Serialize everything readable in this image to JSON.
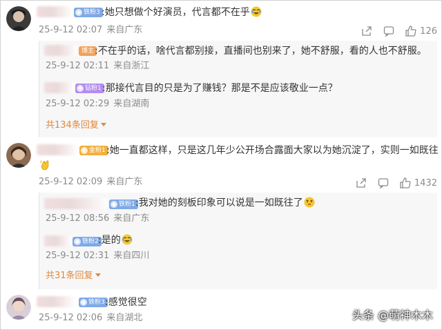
{
  "comments": [
    {
      "badge": "铁粉3",
      "badge_color": "#7fa9e6",
      "text": ":她只想做个好演员，代言都不在乎",
      "date": "25-9-12 02:07",
      "location": "来自广东",
      "likes": "126",
      "replies": [
        {
          "badge": "博主",
          "badge_color": "#f0a35c",
          "text": ":不在乎的话，啥代言都别接，直播间也别来了，她不舒服，看的人也不舒服。",
          "date": "25-9-12 02:11",
          "location": "来自浙江"
        },
        {
          "badge": "钻粉1",
          "badge_color": "#b38cf0",
          "text": ":那接代言目的只是为了赚钱？那是不是应该敬业一点？",
          "date": "25-9-12 02:29",
          "location": "来自湖南"
        }
      ],
      "more_replies": "共134条回复"
    },
    {
      "badge": "金粉1",
      "badge_color": "#f2b03c",
      "text": ":她一直都这样，只是这几年少公开场合露面大家以为她沉淀了，实则一如既往",
      "date": "25-9-12 02:09",
      "location": "来自广东",
      "likes": "1432",
      "replies": [
        {
          "badge": "铁粉1",
          "badge_color": "#7fa9e6",
          "text": ":我对她的刻板印象可以说是一如既往了",
          "date": "25-9-12 08:56",
          "location": "来自广东"
        },
        {
          "badge": "铁粉2",
          "badge_color": "#7fa9e6",
          "text": ":是的",
          "date": "25-9-12 02:31",
          "location": "来自四川"
        }
      ],
      "more_replies": "共31条回复"
    },
    {
      "badge": "铁粉3",
      "badge_color": "#7fa9e6",
      "text": ":感觉很空",
      "date": "25-9-12 02:06",
      "location": "来自湖北"
    }
  ],
  "icons": [
    "share-icon",
    "comment-icon",
    "like-icon",
    "laugh-cry-emoji",
    "clapping-emoji",
    "smirk-emoji"
  ],
  "watermark": "头条 @萌神木木"
}
